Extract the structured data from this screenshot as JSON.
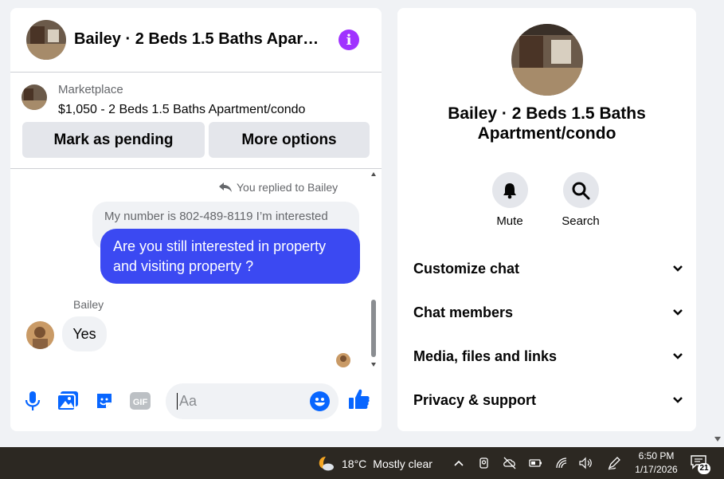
{
  "colors": {
    "accent_blue": "#0866ff",
    "outgoing_bubble": "#3b49f2",
    "info_purple": "#a033ff"
  },
  "chat": {
    "title": "Bailey · 2 Beds 1.5 Baths Apartment/condo",
    "info_icon": "info-icon",
    "marketplace": {
      "label": "Marketplace",
      "listing": "$1,050 - 2 Beds 1.5 Baths Apartment/condo",
      "mark_pending": "Mark as pending",
      "more_options": "More options"
    },
    "messages": {
      "replied_to": "You replied to Bailey",
      "quoted_text": "My number is 802-489-8119 I’m interested",
      "outgoing_text": "Are you still interested in property and visiting property ?",
      "sender_name": "Bailey",
      "incoming_text": "Yes"
    },
    "composer": {
      "placeholder": "Aa",
      "icons": [
        "microphone-icon",
        "photo-icon",
        "sticker-icon",
        "gif-icon",
        "emoji-icon",
        "thumbs-up-icon"
      ],
      "gif_label": "GIF"
    }
  },
  "info_panel": {
    "name": "Bailey · 2 Beds 1.5 Baths Apartment/condo",
    "actions": [
      {
        "label": "Mute",
        "icon": "bell-icon"
      },
      {
        "label": "Search",
        "icon": "search-icon"
      }
    ],
    "sections": [
      {
        "label": "Customize chat"
      },
      {
        "label": "Chat members"
      },
      {
        "label": "Media, files and links"
      },
      {
        "label": "Privacy & support"
      }
    ]
  },
  "taskbar": {
    "weather_temp": "18°C",
    "weather_desc": "Mostly clear",
    "time": "6:50 PM",
    "date": "1/17/2026",
    "notification_count": "21"
  }
}
